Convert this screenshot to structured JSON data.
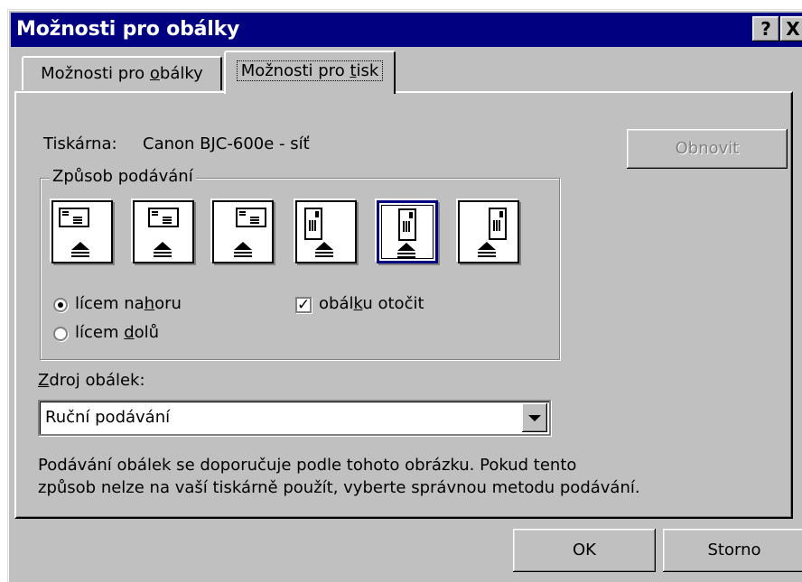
{
  "window": {
    "title": "Možnosti pro obálky",
    "help_label": "?",
    "close_label": "X"
  },
  "tabs": [
    {
      "label_pre": "Možnosti pro ",
      "label_u": "o",
      "label_post": "bálky",
      "active": false
    },
    {
      "label_pre": "Možnosti pro ",
      "label_u": "t",
      "label_post": "isk",
      "active": true
    }
  ],
  "printer": {
    "label": "Tiskárna:",
    "value": "Canon  BJC-600e - síť"
  },
  "refresh_label": "Obnovit",
  "feed": {
    "legend": "Způsob podávání",
    "options": [
      {
        "icon": "envelope-horizontal-left-icon",
        "selected": false
      },
      {
        "icon": "envelope-horizontal-center-icon",
        "selected": false
      },
      {
        "icon": "envelope-horizontal-right-icon",
        "selected": false
      },
      {
        "icon": "envelope-vertical-left-icon",
        "selected": false
      },
      {
        "icon": "envelope-vertical-center-icon",
        "selected": true
      },
      {
        "icon": "envelope-vertical-right-icon",
        "selected": false
      }
    ],
    "face_up": {
      "pre": "lícem na",
      "u": "h",
      "post": "oru",
      "checked": true
    },
    "face_down": {
      "pre": "lícem ",
      "u": "d",
      "post": "olů",
      "checked": false
    },
    "rotate": {
      "pre": "obál",
      "u": "k",
      "post": "u otočit",
      "checked": true
    }
  },
  "source": {
    "label_u": "Z",
    "label_post": "droj obálek:",
    "value": "Ruční podávání"
  },
  "note": {
    "line1": "Podávání obálek se doporučuje podle tohoto obrázku. Pokud tento",
    "line2": "způsob nelze na vaší tiskárně použít, vyberte správnou metodu podávání."
  },
  "buttons": {
    "ok": "OK",
    "cancel": "Storno"
  }
}
